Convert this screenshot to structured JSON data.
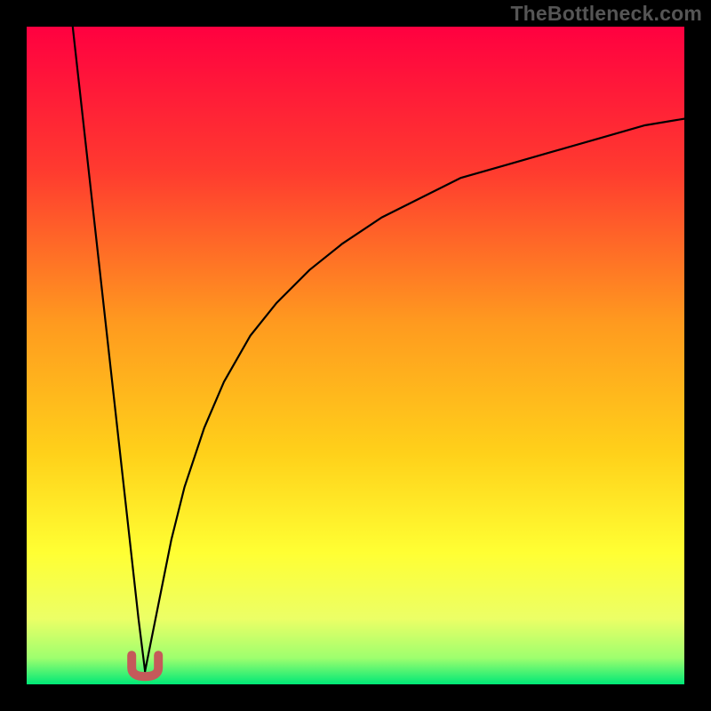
{
  "watermark": "TheBottleneck.com",
  "colors": {
    "marker": "#c55a5a",
    "curve": "#000000",
    "gradient_stops": [
      {
        "offset": "0%",
        "color": "#ff0040"
      },
      {
        "offset": "22%",
        "color": "#ff3b2f"
      },
      {
        "offset": "45%",
        "color": "#ff9a1f"
      },
      {
        "offset": "65%",
        "color": "#ffd11a"
      },
      {
        "offset": "80%",
        "color": "#ffff33"
      },
      {
        "offset": "90%",
        "color": "#ecff66"
      },
      {
        "offset": "96%",
        "color": "#9eff6e"
      },
      {
        "offset": "100%",
        "color": "#00e877"
      }
    ]
  },
  "chart_data": {
    "type": "line",
    "title": "",
    "xlabel": "",
    "ylabel": "",
    "xlim": [
      0,
      100
    ],
    "ylim": [
      0,
      100
    ],
    "description": "Bottleneck-style curve: minimum near x≈18 at y≈2; steep descent from top-left, rising asymptotic branch to the right ending near y≈86 at x=100.",
    "series": [
      {
        "name": "left-branch",
        "x": [
          7,
          8,
          9,
          10,
          11,
          12,
          13,
          14,
          15,
          16,
          17,
          18
        ],
        "y": [
          100,
          91,
          82,
          73,
          64,
          55,
          46,
          37,
          28,
          19,
          10,
          2
        ]
      },
      {
        "name": "right-branch",
        "x": [
          18,
          20,
          22,
          24,
          27,
          30,
          34,
          38,
          43,
          48,
          54,
          60,
          66,
          73,
          80,
          87,
          94,
          100
        ],
        "y": [
          2,
          12,
          22,
          30,
          39,
          46,
          53,
          58,
          63,
          67,
          71,
          74,
          77,
          79,
          81,
          83,
          85,
          86
        ]
      }
    ],
    "marker": {
      "x": 18,
      "y": 2,
      "shape": "u",
      "color": "#c55a5a"
    }
  }
}
